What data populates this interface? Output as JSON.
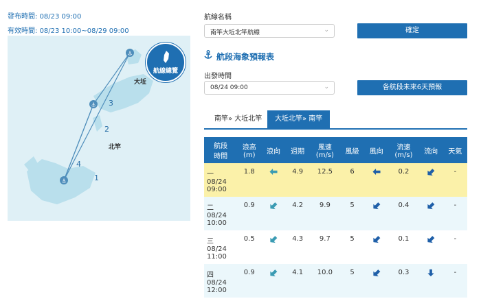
{
  "header": {
    "issue_label": "發布時間:",
    "issue_time": "08/23 09:00",
    "valid_label": "有效時間:",
    "valid_time": "08/23 10:00~08/29 09:00"
  },
  "map": {
    "overview_button": "航線總覽",
    "ports": {
      "dagiu": "大坵",
      "beigan": "北竿",
      "nangan": "南竿"
    },
    "routes": [
      "1",
      "2",
      "3",
      "4"
    ]
  },
  "form": {
    "route_label": "航線名稱",
    "route_value": "南竿大坵北竿航線",
    "confirm_button": "確定",
    "section_title": "航段海象預報表",
    "depart_label": "出發時間",
    "depart_value": "08/24 09:00",
    "six_day_button": "各航段未來6天預報"
  },
  "tabs": [
    {
      "label": "南竿» 大坵北竿",
      "active": false
    },
    {
      "label": "大坵北竿» 南竿",
      "active": true
    }
  ],
  "table": {
    "headers": [
      [
        "航段",
        "時間"
      ],
      [
        "浪高",
        "(m)"
      ],
      [
        "浪向"
      ],
      [
        "週期"
      ],
      [
        "風速",
        "(m/s)"
      ],
      [
        "風級"
      ],
      [
        "風向"
      ],
      [
        "流速",
        "(m/s)"
      ],
      [
        "流向"
      ],
      [
        "天氣"
      ]
    ],
    "rows": [
      {
        "seg": "一",
        "date": "08/24",
        "time": "09:00",
        "wave_h": "1.8",
        "wave_dir": "west-arrow-icon",
        "period": "4.9",
        "wind_speed": "12.5",
        "wind_level": "6",
        "wind_dir": "west-arrow-icon",
        "current_speed": "0.2",
        "current_dir": "southwest-arrow-icon",
        "weather": "-"
      },
      {
        "seg": "二",
        "date": "08/24",
        "time": "10:00",
        "wave_h": "0.9",
        "wave_dir": "southwest-arrow-icon",
        "period": "4.2",
        "wind_speed": "9.9",
        "wind_level": "5",
        "wind_dir": "southwest-arrow-icon",
        "current_speed": "0.4",
        "current_dir": "southwest-arrow-icon",
        "weather": "-"
      },
      {
        "seg": "三",
        "date": "08/24",
        "time": "11:00",
        "wave_h": "0.5",
        "wave_dir": "southwest-arrow-icon",
        "period": "4.3",
        "wind_speed": "9.7",
        "wind_level": "5",
        "wind_dir": "southwest-arrow-icon",
        "current_speed": "0.1",
        "current_dir": "southwest-arrow-icon",
        "weather": "-"
      },
      {
        "seg": "四",
        "date": "08/24",
        "time": "12:00",
        "wave_h": "0.9",
        "wave_dir": "southwest-arrow-icon",
        "period": "4.1",
        "wind_speed": "10.0",
        "wind_level": "5",
        "wind_dir": "southwest-arrow-icon",
        "current_speed": "0.3",
        "current_dir": "south-arrow-icon",
        "weather": "-"
      }
    ]
  },
  "colors": {
    "accent": "#1f6fb2",
    "highlight_row": "#fbf1a9",
    "alt_row": "#ebf7fb",
    "map_bg": "#dff0f6",
    "wave_arrow": "#3a9bb3",
    "wind_arrow": "#1f5fa8"
  }
}
